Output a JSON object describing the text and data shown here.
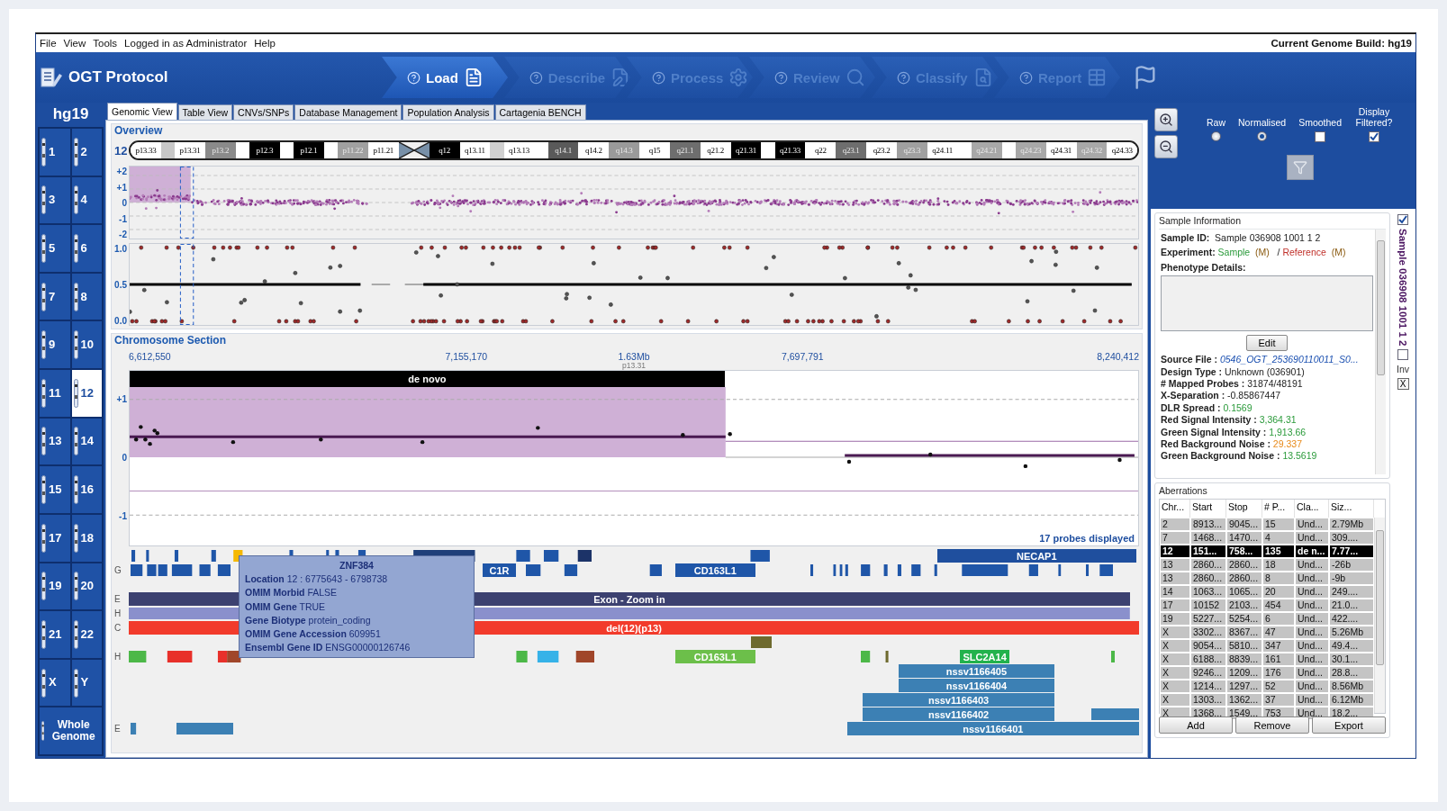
{
  "menu": {
    "items": [
      {
        "label": "File"
      },
      {
        "label": "View"
      },
      {
        "label": "Tools"
      },
      {
        "label": "Logged in as Administrator"
      },
      {
        "label": "Help"
      }
    ],
    "build": "Current Genome Build: hg19"
  },
  "header": {
    "title": "OGT Protocol",
    "steps": [
      {
        "label": "Load",
        "selected": true
      },
      {
        "label": "Describe",
        "selected": false
      },
      {
        "label": "Process",
        "selected": false
      },
      {
        "label": "Review",
        "selected": false
      },
      {
        "label": "Classify",
        "selected": false
      },
      {
        "label": "Report",
        "selected": false
      }
    ]
  },
  "genome": {
    "build": "hg19",
    "chromosomes": [
      {
        "label": "1",
        "selected": false
      },
      {
        "label": "2",
        "selected": false
      },
      {
        "label": "3",
        "selected": false
      },
      {
        "label": "4",
        "selected": false
      },
      {
        "label": "5",
        "selected": false
      },
      {
        "label": "6",
        "selected": false
      },
      {
        "label": "7",
        "selected": false
      },
      {
        "label": "8",
        "selected": false
      },
      {
        "label": "9",
        "selected": false
      },
      {
        "label": "10",
        "selected": false
      },
      {
        "label": "11",
        "selected": false
      },
      {
        "label": "12",
        "selected": true
      },
      {
        "label": "13",
        "selected": false
      },
      {
        "label": "14",
        "selected": false
      },
      {
        "label": "15",
        "selected": false
      },
      {
        "label": "16",
        "selected": false
      },
      {
        "label": "17",
        "selected": false
      },
      {
        "label": "18",
        "selected": false
      },
      {
        "label": "19",
        "selected": false
      },
      {
        "label": "20",
        "selected": false
      },
      {
        "label": "21",
        "selected": false
      },
      {
        "label": "22",
        "selected": false
      },
      {
        "label": "X",
        "selected": false
      },
      {
        "label": "Y",
        "selected": false
      },
      {
        "label": "Whole Genome",
        "selected": false,
        "kind": "whole"
      }
    ]
  },
  "tabs": [
    {
      "label": "Genomic View",
      "selected": true
    },
    {
      "label": "Table View",
      "selected": false
    },
    {
      "label": "CNVs/SNPs",
      "selected": false
    },
    {
      "label": "Database Management",
      "selected": false
    },
    {
      "label": "Population Analysis",
      "selected": false
    },
    {
      "label": "Cartagenia BENCH",
      "selected": false
    }
  ],
  "overview": {
    "title": "Overview",
    "chromosome": "12",
    "bands": [
      {
        "kind": "band",
        "label": "p13.33",
        "color": "#ffffff"
      },
      {
        "kind": "band",
        "color": "#c8c8c8"
      },
      {
        "kind": "band",
        "label": "p13.31",
        "color": "#ffffff"
      },
      {
        "kind": "band",
        "label": "p13.2",
        "color": "#8a8a8a"
      },
      {
        "kind": "band",
        "color": "#ffffff"
      },
      {
        "kind": "band",
        "label": "p12.3",
        "color": "#000000"
      },
      {
        "kind": "band",
        "color": "#ffffff"
      },
      {
        "kind": "band",
        "label": "p12.1",
        "color": "#000000"
      },
      {
        "kind": "band",
        "color": "#ffffff"
      },
      {
        "kind": "band",
        "label": "p11.22",
        "color": "#a0a0a0"
      },
      {
        "kind": "band",
        "label": "p11.21",
        "color": "#ffffff"
      },
      {
        "kind": "centromere"
      },
      {
        "kind": "band",
        "label": "q12",
        "color": "#000000"
      },
      {
        "kind": "band",
        "label": "q13.11",
        "color": "#ffffff"
      },
      {
        "kind": "band",
        "color": "#d0d0d0"
      },
      {
        "kind": "band",
        "label": "q13.13",
        "color": "#ffffff"
      },
      {
        "kind": "band",
        "color": "#ffffff"
      },
      {
        "kind": "band",
        "label": "q14.1",
        "color": "#5a5a5a"
      },
      {
        "kind": "band",
        "label": "q14.2",
        "color": "#ffffff"
      },
      {
        "kind": "band",
        "label": "q14.3",
        "color": "#9a9a9a"
      },
      {
        "kind": "band",
        "label": "q15",
        "color": "#ffffff"
      },
      {
        "kind": "band",
        "label": "q21.1",
        "color": "#6e6e6e"
      },
      {
        "kind": "band",
        "label": "q21.2",
        "color": "#ffffff"
      },
      {
        "kind": "band",
        "label": "q21.31",
        "color": "#000000"
      },
      {
        "kind": "band",
        "color": "#ffffff"
      },
      {
        "kind": "band",
        "label": "q21.33",
        "color": "#000000"
      },
      {
        "kind": "band",
        "label": "q22",
        "color": "#ffffff"
      },
      {
        "kind": "band",
        "label": "q23.1",
        "color": "#6e6e6e"
      },
      {
        "kind": "band",
        "label": "q23.2",
        "color": "#ffffff"
      },
      {
        "kind": "band",
        "label": "q23.3",
        "color": "#a0a0a0"
      },
      {
        "kind": "band",
        "label": "q24.11",
        "color": "#ffffff"
      },
      {
        "kind": "band",
        "color": "#ffffff"
      },
      {
        "kind": "band",
        "label": "q24.21",
        "color": "#a8a8a8"
      },
      {
        "kind": "band",
        "color": "#ffffff"
      },
      {
        "kind": "band",
        "label": "q24.23",
        "color": "#a8a8a8"
      },
      {
        "kind": "band",
        "label": "q24.31",
        "color": "#ffffff"
      },
      {
        "kind": "band",
        "label": "q24.32",
        "color": "#a8a8a8"
      },
      {
        "kind": "band",
        "label": "q24.33",
        "color": "#ffffff"
      }
    ],
    "log_ratio_ticks": [
      "+2",
      "+1",
      "0",
      "-1",
      "-2"
    ],
    "baf_ticks": [
      "1.0",
      "0.5",
      "0.0"
    ]
  },
  "section": {
    "title": "Chromosome Section",
    "axis_labels": [
      "6,612,550",
      "7,155,170",
      "1.63Mb",
      "7,697,791",
      "8,240,412"
    ],
    "band": "p13.31",
    "call": "de novo",
    "ticks": [
      "+1",
      "0",
      "-1"
    ],
    "probe_count": "17 probes displayed",
    "tracks": [
      {
        "features": [
          {
            "label": "NECAP1"
          }
        ]
      },
      {
        "tag": "G",
        "features": [
          {
            "label": "C1R"
          },
          {
            "label": "CD163L1"
          }
        ]
      },
      {
        "tag": "E",
        "features": [
          {
            "label": "Exon - Zoom in"
          }
        ]
      },
      {
        "tag": "H"
      },
      {
        "tag": "C",
        "features": [
          {
            "label": "del(12)(p13)"
          }
        ]
      },
      {
        "tag": "H",
        "features": [
          {
            "label": "CD163L1"
          },
          {
            "label": "SLC2A14"
          }
        ]
      },
      {
        "features": [
          {
            "label": "nssv1166405"
          }
        ]
      },
      {
        "features": [
          {
            "label": "nssv1166404"
          }
        ]
      },
      {
        "features": [
          {
            "label": "nssv1166403"
          }
        ]
      },
      {
        "features": [
          {
            "label": "nssv1166402"
          }
        ]
      },
      {
        "tag": "E",
        "features": [
          {
            "label": "nssv1166401"
          }
        ]
      }
    ],
    "tooltip": {
      "title": "ZNF384",
      "lines": [
        "**Location** 12 : 6775643 - 6798738",
        "**OMIM Morbid** FALSE",
        "**OMIM Gene** TRUE",
        "**Gene Biotype** protein_coding",
        "**OMIM Gene Accession** 609951",
        "**Ensembl Gene ID** ENSG00000126746"
      ]
    }
  },
  "view_options": {
    "modes": [
      {
        "label": "Raw",
        "selected": false
      },
      {
        "label": "Normalised",
        "selected": true
      }
    ],
    "smoothed": {
      "label": "Smoothed",
      "checked": false
    },
    "filtered": {
      "label": "Display Filtered?",
      "checked": true
    }
  },
  "sample_info": {
    "title": "Sample Information",
    "sample_id": {
      "label": "Sample ID:",
      "value": "Sample 036908 1001 1 2"
    },
    "experiment": {
      "label": "Experiment:",
      "sample": "Sample",
      "sample_tag": "(M)",
      "separator": "/",
      "reference": "Reference",
      "reference_tag": "(M)"
    },
    "phenotype_label": "Phenotype Details:",
    "edit": "Edit",
    "stats": [
      {
        "label": "Source File :",
        "value": "0546_OGT_253690110011_S0...",
        "kind": "link"
      },
      {
        "label": "Design Type :",
        "value": "Unknown (036901)",
        "kind": "plain"
      },
      {
        "label": "# Mapped Probes :",
        "value": "31874/48191",
        "kind": "plain"
      },
      {
        "label": "X-Separation :",
        "value": "-0.85867447",
        "kind": "plain"
      },
      {
        "label": "DLR Spread :",
        "value": "0.1569",
        "kind": "good"
      },
      {
        "label": "Red Signal Intensity :",
        "value": "3,364.31",
        "kind": "good"
      },
      {
        "label": "Green Signal Intensity :",
        "value": "1,913.66",
        "kind": "good"
      },
      {
        "label": "Red Background Noise :",
        "value": "29.337",
        "kind": "warn"
      },
      {
        "label": "Green Background Noise :",
        "value": "13.5619",
        "kind": "good"
      }
    ]
  },
  "sample_tab": {
    "checked": true,
    "title": "Sample 036908 1001 1 2",
    "inverted": {
      "label": "Inv",
      "checked": false
    },
    "close": "X"
  },
  "aberrations": {
    "title": "Aberrations",
    "columns": [
      "Chr...",
      "Start",
      "Stop",
      "# P...",
      "Cla...",
      "Siz..."
    ],
    "rows": [
      {
        "cells": [
          "2",
          "8913...",
          "9045...",
          "15",
          "Und...",
          "2.79Mb"
        ],
        "selected": false
      },
      {
        "cells": [
          "7",
          "1468...",
          "1470...",
          "4",
          "Und...",
          "309...."
        ],
        "selected": false
      },
      {
        "cells": [
          "12",
          "151...",
          "758...",
          "135",
          "de n...",
          "7.77..."
        ],
        "selected": true
      },
      {
        "cells": [
          "13",
          "2860...",
          "2860...",
          "18",
          "Und...",
          "-26b"
        ],
        "selected": false
      },
      {
        "cells": [
          "13",
          "2860...",
          "2860...",
          "8",
          "Und...",
          "-9b"
        ],
        "selected": false
      },
      {
        "cells": [
          "14",
          "1063...",
          "1065...",
          "20",
          "Und...",
          "249...."
        ],
        "selected": false
      },
      {
        "cells": [
          "17",
          "10152",
          "2103...",
          "454",
          "Und...",
          "21.0..."
        ],
        "selected": false
      },
      {
        "cells": [
          "19",
          "5227...",
          "5254...",
          "6",
          "Und...",
          "422...."
        ],
        "selected": false
      },
      {
        "cells": [
          "X",
          "3302...",
          "8367...",
          "47",
          "Und...",
          "5.26Mb"
        ],
        "selected": false
      },
      {
        "cells": [
          "X",
          "9054...",
          "5810...",
          "347",
          "Und...",
          "49.4..."
        ],
        "selected": false
      },
      {
        "cells": [
          "X",
          "6188...",
          "8839...",
          "161",
          "Und...",
          "30.1..."
        ],
        "selected": false
      },
      {
        "cells": [
          "X",
          "9246...",
          "1209...",
          "176",
          "Und...",
          "28.8..."
        ],
        "selected": false
      },
      {
        "cells": [
          "X",
          "1214...",
          "1297...",
          "52",
          "Und...",
          "8.56Mb"
        ],
        "selected": false
      },
      {
        "cells": [
          "X",
          "1303...",
          "1362...",
          "37",
          "Und...",
          "6.12Mb"
        ],
        "selected": false
      },
      {
        "cells": [
          "X",
          "1368...",
          "1549...",
          "753",
          "Und...",
          "18.2..."
        ],
        "selected": false
      }
    ],
    "buttons": [
      "Add",
      "Remove",
      "Export"
    ]
  }
}
